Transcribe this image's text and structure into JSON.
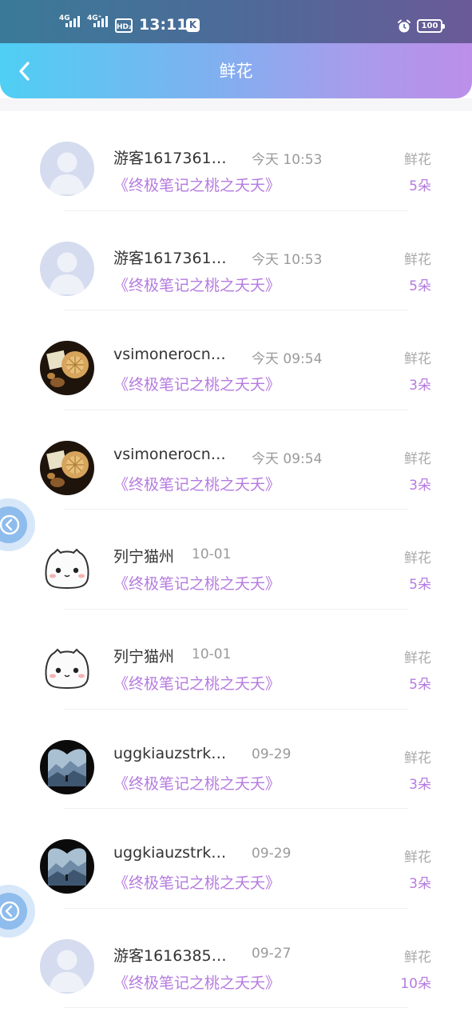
{
  "status_bar": {
    "net1": "4G",
    "net2": "4G⁺",
    "hd": "HD₂",
    "time": "13:11",
    "app_badge": "K",
    "battery": "100"
  },
  "header": {
    "title": "鲜花",
    "back_icon": "chevron-left-icon",
    "gradient_colors": [
      "#4fcff3",
      "#bb8fe9"
    ]
  },
  "colors": {
    "accent": "#b57be0",
    "name_text": "#333333",
    "muted_text": "#9a9a9a"
  },
  "records": [
    {
      "name": "游客1617361…",
      "time": "今天 10:53",
      "book": "《终极笔记之桃之夭夭》",
      "gift": "鲜花",
      "count": "5朵",
      "avatar": "default-user"
    },
    {
      "name": "游客1617361…",
      "time": "今天 10:53",
      "book": "《终极笔记之桃之夭夭》",
      "gift": "鲜花",
      "count": "5朵",
      "avatar": "default-user"
    },
    {
      "name": "vsimonerocn…",
      "time": "今天 09:54",
      "book": "《终极笔记之桃之夭夭》",
      "gift": "鲜花",
      "count": "3朵",
      "avatar": "cookie-photo"
    },
    {
      "name": "vsimonerocn…",
      "time": "今天 09:54",
      "book": "《终极笔记之桃之夭夭》",
      "gift": "鲜花",
      "count": "3朵",
      "avatar": "cookie-photo"
    },
    {
      "name": "列宁猫州",
      "time": "10-01",
      "book": "《终极笔记之桃之夭夭》",
      "gift": "鲜花",
      "count": "5朵",
      "avatar": "cartoon-cat"
    },
    {
      "name": "列宁猫州",
      "time": "10-01",
      "book": "《终极笔记之桃之夭夭》",
      "gift": "鲜花",
      "count": "5朵",
      "avatar": "cartoon-cat"
    },
    {
      "name": "uggkiauzstrk…",
      "time": "09-29",
      "book": "《终极笔记之桃之夭夭》",
      "gift": "鲜花",
      "count": "3朵",
      "avatar": "mountain-heart"
    },
    {
      "name": "uggkiauzstrk…",
      "time": "09-29",
      "book": "《终极笔记之桃之夭夭》",
      "gift": "鲜花",
      "count": "3朵",
      "avatar": "mountain-heart"
    },
    {
      "name": "游客1616385…",
      "time": "09-27",
      "book": "《终极笔记之桃之夭夭》",
      "gift": "鲜花",
      "count": "10朵",
      "avatar": "default-user"
    }
  ],
  "floating_buttons": [
    {
      "icon": "collapse-left-icon"
    },
    {
      "icon": "collapse-left-icon"
    }
  ]
}
